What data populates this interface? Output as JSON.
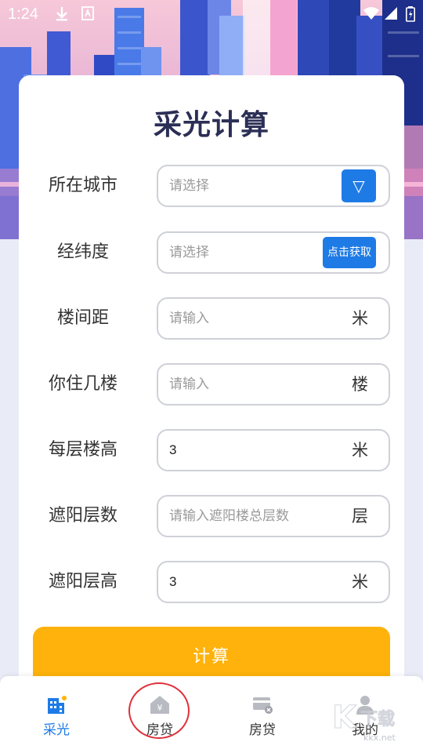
{
  "status_bar": {
    "time": "1:24"
  },
  "page_title": "采光计算",
  "form": {
    "city": {
      "label": "所在城市",
      "placeholder": "请选择",
      "value": ""
    },
    "coordinates": {
      "label": "经纬度",
      "placeholder": "请选择",
      "value": "",
      "button": "点击获取"
    },
    "building_distance": {
      "label": "楼间距",
      "placeholder": "请输入",
      "value": "",
      "unit": "米"
    },
    "your_floor": {
      "label": "你住几楼",
      "placeholder": "请输入",
      "value": "",
      "unit": "楼"
    },
    "floor_height": {
      "label": "每层楼高",
      "placeholder": "",
      "value": "3",
      "unit": "米"
    },
    "shade_floors": {
      "label": "遮阳层数",
      "placeholder": "请输入遮阳楼总层数",
      "value": "",
      "unit": "层"
    },
    "shade_floor_height": {
      "label": "遮阳层高",
      "placeholder": "",
      "value": "3",
      "unit": "米"
    }
  },
  "calculate_button": "计算",
  "bottom_nav": {
    "items": [
      {
        "label": "采光",
        "icon": "building-sun-icon",
        "active": true
      },
      {
        "label": "房贷",
        "icon": "house-yuan-icon",
        "active": false
      },
      {
        "label": "房贷",
        "icon": "card-calculator-icon",
        "active": false
      },
      {
        "label": "我的",
        "icon": "person-icon",
        "active": false
      }
    ]
  },
  "watermark": "kkx.net",
  "colors": {
    "accent": "#1e7be6",
    "calc_button": "#ffb20b",
    "title": "#2b2e55",
    "annotation_circle": "#e0303a"
  }
}
